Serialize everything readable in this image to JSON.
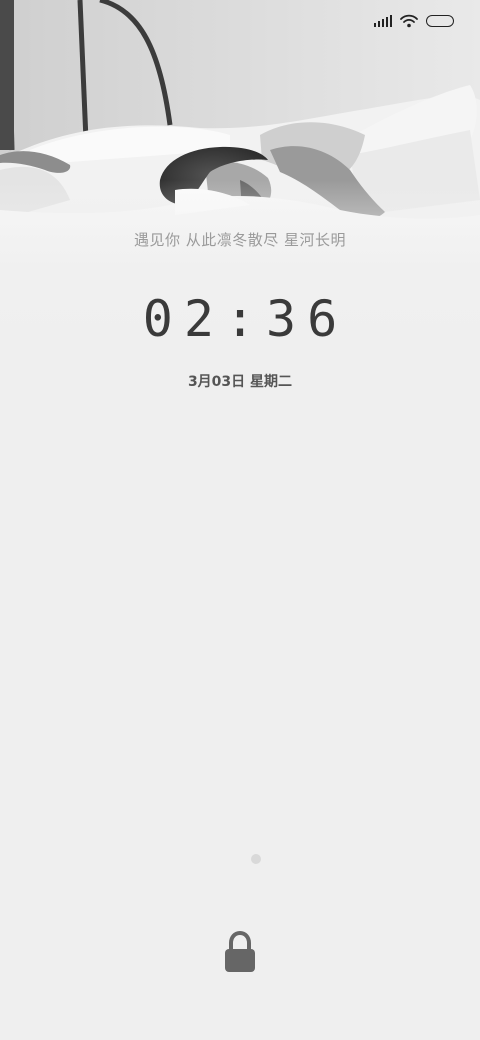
{
  "status_bar": {
    "signal_icon": "cellular-signal-icon",
    "wifi_icon": "wifi-icon",
    "battery_icon": "battery-icon"
  },
  "lockscreen": {
    "quote": "遇见你 从此凛冬散尽 星河长明",
    "time": "02:36",
    "date": "3月03日 星期二",
    "lock_icon": "lock-icon"
  },
  "colors": {
    "background": "#efefef",
    "clock_text": "#3a3a3a",
    "quote_text": "#9a9a9a",
    "lock_icon": "#666666"
  }
}
